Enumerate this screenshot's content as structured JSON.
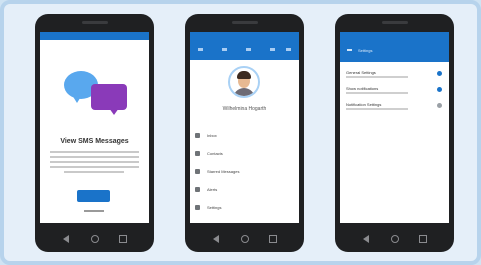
{
  "colors": {
    "accent": "#1a73c9",
    "frame": "#b7d3ec",
    "phone_body": "#1f2022"
  },
  "phones": [
    {
      "id": "onboarding",
      "welcome_title": "View SMS Messages",
      "icons": [
        "chat-bubble-blue-icon",
        "chat-bubble-purple-icon"
      ]
    },
    {
      "id": "profile",
      "profile_name": "Wilhelmina Hogarth",
      "menu": [
        {
          "label": "Inbox",
          "icon": "inbox-icon"
        },
        {
          "label": "Contacts",
          "icon": "contacts-icon"
        },
        {
          "label": "Starred Messages",
          "icon": "star-icon"
        },
        {
          "label": "Alerts",
          "icon": "bell-icon"
        },
        {
          "label": "Settings",
          "icon": "gear-icon"
        }
      ]
    },
    {
      "id": "settings",
      "title": "Settings",
      "settings": [
        {
          "title": "General Settings",
          "enabled": true
        },
        {
          "title": "Show notifications",
          "enabled": true
        },
        {
          "title": "Notification Settings",
          "enabled": false
        }
      ]
    }
  ]
}
